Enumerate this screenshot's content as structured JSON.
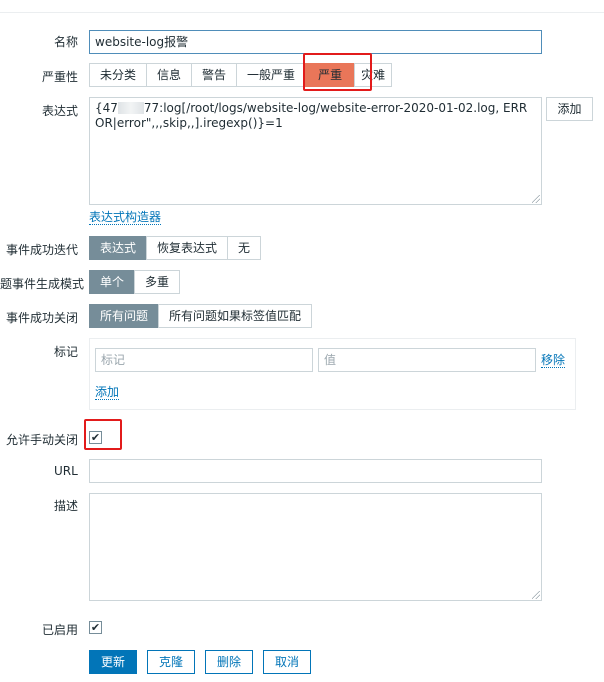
{
  "form": {
    "name_label": "名称",
    "name_value": "website-log报警",
    "severity_label": "严重性",
    "severity_options": [
      "未分类",
      "信息",
      "警告",
      "一般严重",
      "严重",
      "灾难"
    ],
    "severity_selected": "严重",
    "expression_label": "表达式",
    "expression_prefix": "{47",
    "expression_rest": "77:log[/root/logs/website-log/website-error-2020-01-02.log, ERROR|error\",,,skip,,].iregexp()}=1",
    "expression_add_button": "添加",
    "expression_builder_link": "表达式构造器",
    "ok_event_gen_label": "事件成功迭代",
    "ok_event_gen_options": [
      "表达式",
      "恢复表达式",
      "无"
    ],
    "ok_event_gen_selected": "表达式",
    "problem_mode_label": "题事件生成模式",
    "problem_mode_options": [
      "单个",
      "多重"
    ],
    "problem_mode_selected": "单个",
    "ok_close_label": "事件成功关闭",
    "ok_close_options": [
      "所有问题",
      "所有问题如果标签值匹配"
    ],
    "ok_close_selected": "所有问题",
    "tags_label": "标记",
    "tag_placeholder": "标记",
    "value_placeholder": "值",
    "remove_link": "移除",
    "add_link": "添加",
    "manual_close_label": "允许手动关闭",
    "manual_close_checked": true,
    "url_label": "URL",
    "url_value": "",
    "description_label": "描述",
    "description_value": "",
    "enabled_label": "已启用",
    "enabled_checked": true
  },
  "actions": {
    "update": "更新",
    "clone": "克隆",
    "delete": "删除",
    "cancel": "取消"
  },
  "colors": {
    "accent": "#0275b8",
    "selected_segment": "#768d99",
    "severity_high": "#e97659",
    "highlight_box": "#e21b1b"
  }
}
